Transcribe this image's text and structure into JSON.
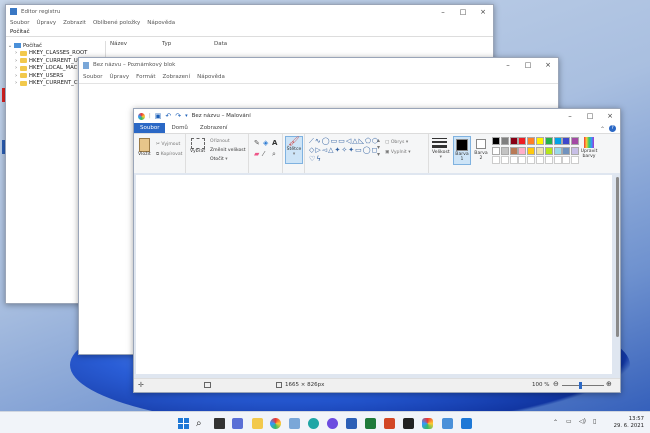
{
  "registry": {
    "title": "Editor registru",
    "menu": [
      "Soubor",
      "Úpravy",
      "Zobrazit",
      "Oblíbené položky",
      "Nápověda"
    ],
    "address": "Počítač",
    "tree": [
      "Počítač",
      "HKEY_CLASSES_ROOT",
      "HKEY_CURRENT_USER",
      "HKEY_LOCAL_MAC",
      "HKEY_USERS",
      "HKEY_CURRENT_C"
    ],
    "columns": [
      "Název",
      "Typ",
      "Data"
    ]
  },
  "notepad": {
    "title": "Bez názvu – Poznámkový blok",
    "menu": [
      "Soubor",
      "Úpravy",
      "Formát",
      "Zobrazení",
      "Nápověda"
    ]
  },
  "paint": {
    "title": "Bez názvu – Malování",
    "tabs": [
      "Soubor",
      "Domů",
      "Zobrazení"
    ],
    "clipboard": {
      "paste": "Vložit",
      "cut": "Vyjmout",
      "copy": "Kopírovat",
      "label": "Schránka"
    },
    "image": {
      "select": "Vybrat",
      "crop": "Oříznout",
      "resize": "Změnit velikost",
      "rotate": "Otočit",
      "label": "Obrázek"
    },
    "tools": {
      "label": "Nástroje"
    },
    "brushes": {
      "label": "Štětce"
    },
    "shapes": {
      "outline": "Obrys",
      "fill": "Vyplnit",
      "label": "Tvary"
    },
    "size": {
      "label": "Velikost"
    },
    "colors": {
      "color1": "Barva 1",
      "color2": "Barva 2",
      "edit": "Upravit barvy",
      "label": "Barvy",
      "palette": [
        "#000000",
        "#7f7f7f",
        "#880015",
        "#ed1c24",
        "#ff7f27",
        "#fff200",
        "#22b14c",
        "#00a2e8",
        "#3f48cc",
        "#a349a4",
        "#ffffff",
        "#c3c3c3",
        "#b97a57",
        "#ffaec9",
        "#ffc90e",
        "#efe4b0",
        "#b5e61d",
        "#99d9ea",
        "#7092be",
        "#c8bfe7"
      ]
    },
    "status": {
      "dimensions": "1665 × 826px",
      "zoom": "100 %"
    }
  },
  "taskbar": {
    "time": "13:57",
    "date": "29. 6. 2021"
  }
}
